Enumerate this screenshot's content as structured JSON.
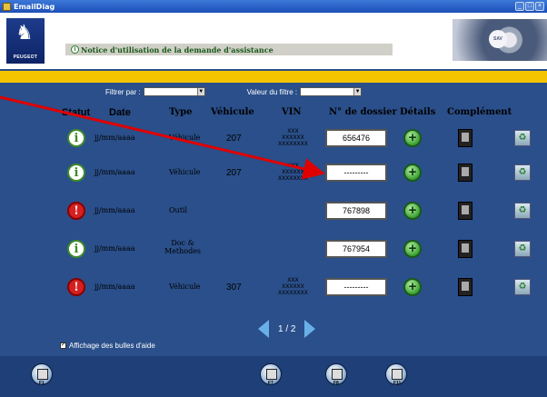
{
  "window": {
    "title": "EmailDiag"
  },
  "header": {
    "brand": "PEUGEOT",
    "notice": "Notice d'utilisation de la demande d'assistance",
    "art_label": "SAV"
  },
  "filter": {
    "label": "Filtrer par :",
    "value_label": "Valeur du filtre :",
    "filter_value": "",
    "value_value": ""
  },
  "columns": [
    "Statut",
    "Date",
    "Type",
    "Véhicule",
    "VIN",
    "N° de dossier",
    "Détails",
    "Complément"
  ],
  "rows": [
    {
      "status": "ok",
      "date": "jj/mm/aaaa",
      "type": "Véhicule",
      "vehicule": "207",
      "vin": [
        "XXX",
        "XXXXXX",
        "XXXXXXXX"
      ],
      "dossier": "656476"
    },
    {
      "status": "ok",
      "date": "jj/mm/aaaa",
      "type": "Véhicule",
      "vehicule": "207",
      "vin": [
        "XXX",
        "XXXXXX",
        "XXXXXXXX"
      ],
      "dossier": "---------"
    },
    {
      "status": "warn",
      "date": "jj/mm/aaaa",
      "type": "Outil",
      "vehicule": "",
      "vin": [
        "",
        "",
        ""
      ],
      "dossier": "767898"
    },
    {
      "status": "ok",
      "date": "jj/mm/aaaa",
      "type": "Doc & Methodes",
      "vehicule": "",
      "vin": [
        "",
        "",
        ""
      ],
      "dossier": "767954"
    },
    {
      "status": "warn",
      "date": "jj/mm/aaaa",
      "type": "Véhicule",
      "vehicule": "307",
      "vin": [
        "XXX",
        "XXXXXX",
        "XXXXXXXX"
      ],
      "dossier": "---------"
    }
  ],
  "pager": {
    "text": "1 / 2"
  },
  "help": {
    "label": "Affichage des bulles d'aide",
    "checked": true
  },
  "footer": {
    "buttons": [
      "F1",
      "F7",
      "F8",
      "F11"
    ]
  },
  "colors": {
    "background": "#2a4f8a",
    "accent": "#f5c400",
    "status_ok": "#3d8a2a",
    "status_warn": "#d42020",
    "annotation": "#e00000"
  }
}
